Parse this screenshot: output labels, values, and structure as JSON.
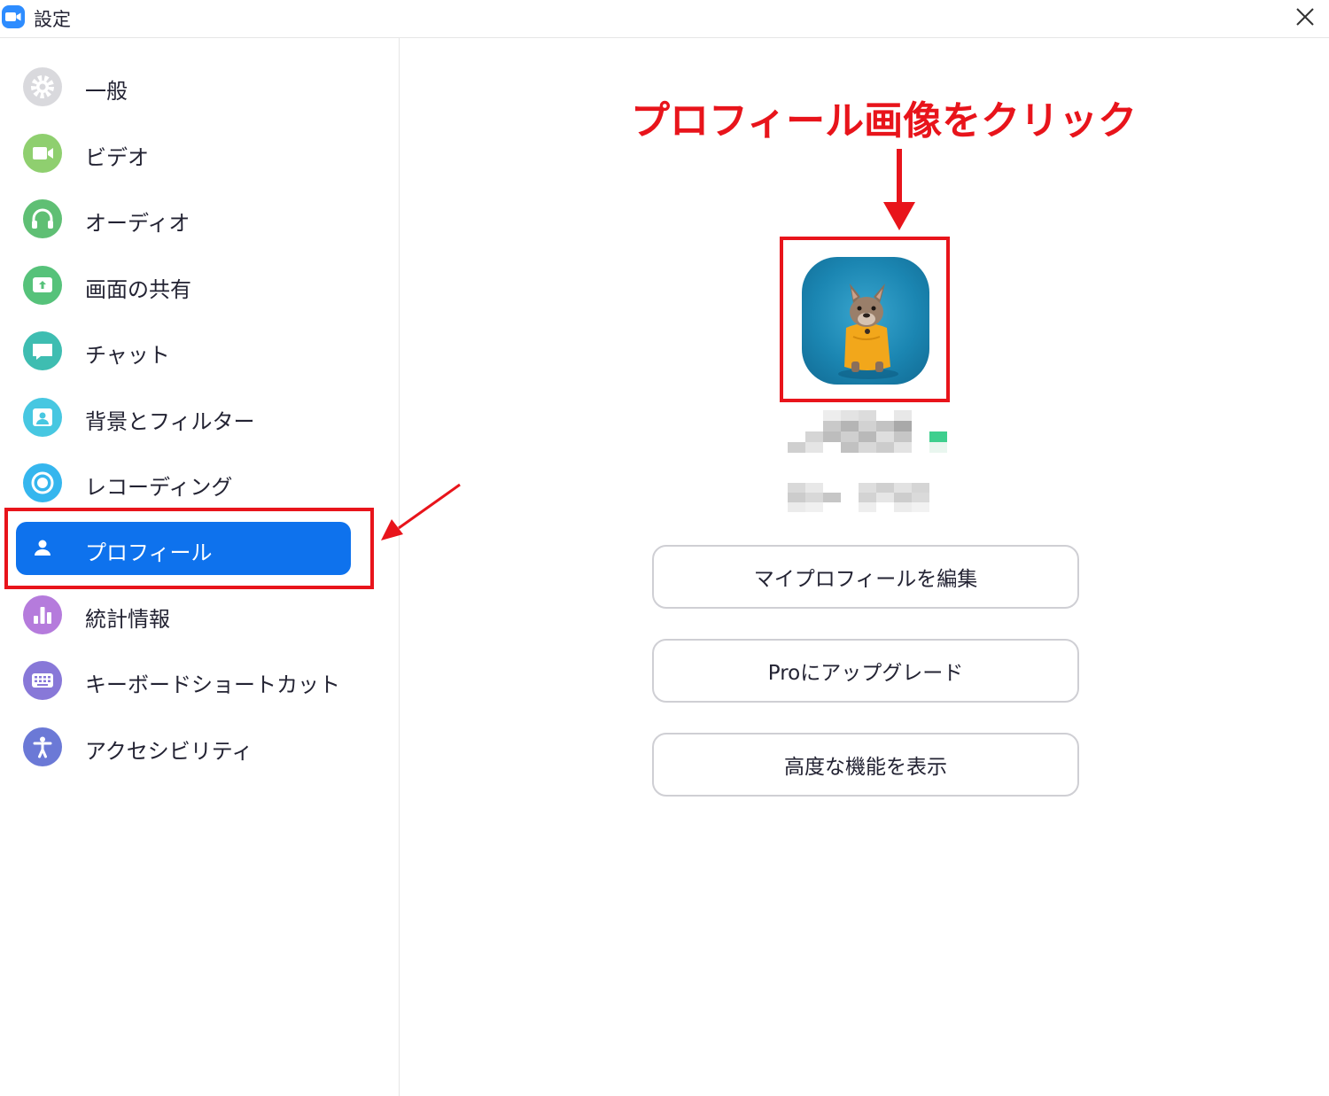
{
  "window": {
    "title": "設定"
  },
  "sidebar": {
    "items": [
      {
        "label": "一般",
        "icon": "gear-icon",
        "color": "#d9d9dd"
      },
      {
        "label": "ビデオ",
        "icon": "video-camera-icon",
        "color": "#8fcf6f"
      },
      {
        "label": "オーディオ",
        "icon": "headphones-icon",
        "color": "#5fbf74"
      },
      {
        "label": "画面の共有",
        "icon": "share-screen-icon",
        "color": "#56c27a"
      },
      {
        "label": "チャット",
        "icon": "chat-bubble-icon",
        "color": "#3ebdb1"
      },
      {
        "label": "背景とフィルター",
        "icon": "background-filter-icon",
        "color": "#47c7e1"
      },
      {
        "label": "レコーディング",
        "icon": "record-icon",
        "color": "#35b6ee"
      },
      {
        "label": "プロフィール",
        "icon": "person-icon",
        "color": "#0E72ED",
        "active": true
      },
      {
        "label": "統計情報",
        "icon": "statistics-icon",
        "color": "#b57bdc"
      },
      {
        "label": "キーボードショートカット",
        "icon": "keyboard-icon",
        "color": "#8878d8"
      },
      {
        "label": "アクセシビリティ",
        "icon": "accessibility-icon",
        "color": "#6b79d6"
      }
    ]
  },
  "main": {
    "annotation": "プロフィール画像をクリック",
    "buttons": {
      "edit_profile": "マイプロフィールを編集",
      "upgrade": "Proにアップグレード",
      "advanced": "高度な機能を表示"
    }
  },
  "colors": {
    "accent": "#0E72ED",
    "annotation_red": "#E8141B",
    "status_green": "#3ecf8e"
  }
}
